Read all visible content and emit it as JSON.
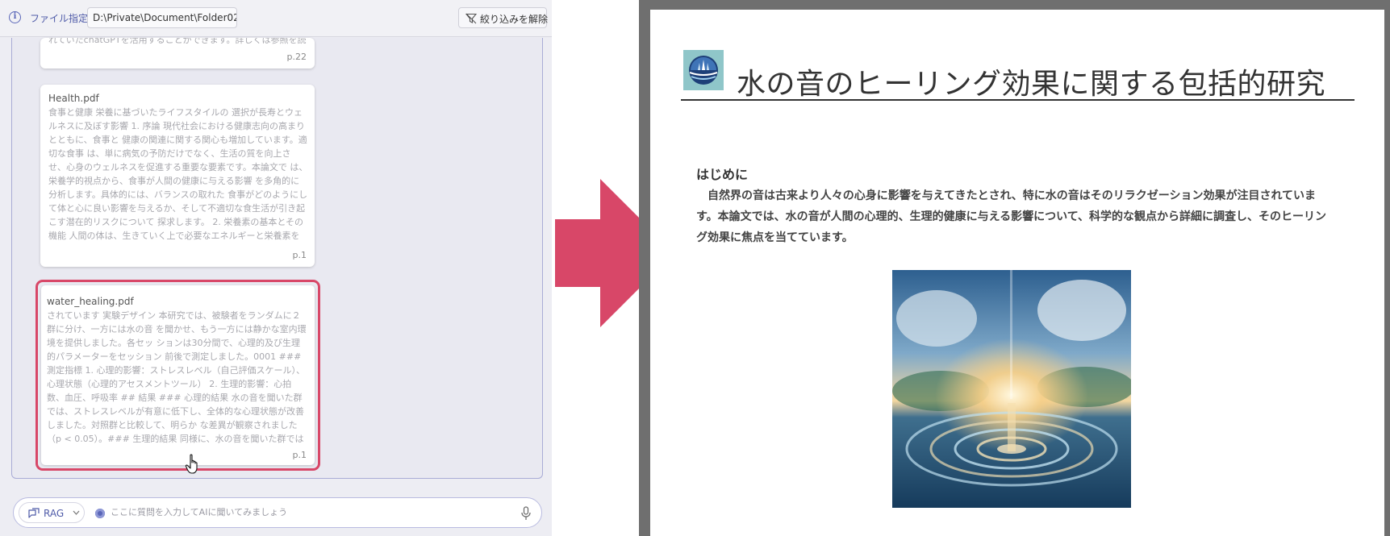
{
  "toolbar": {
    "file_label": "ファイル指定",
    "path": "D:\\Private\\Document\\Folder02\\",
    "filter_clear_label": "絞り込みを解除"
  },
  "results": [
    {
      "title": "",
      "body": "れていたchatGPTを活用することができます。詳しくは参照を読み",
      "page": "p.22"
    },
    {
      "title": "Health.pdf",
      "body": "食事と健康 栄養に基づいたライフスタイルの 選択が長寿とウェルネスに及ぼす影響 1. 序論 現代社会における健康志向の高まりとともに、食事と 健康の関連に関する関心も増加しています。適切な食事 は、単に病気の予防だけでなく、生活の質を向上させ、心身のウェルネスを促進する重要な要素です。本論文で は、栄養学的視点から、食事が人間の健康に与える影響 を多角的に分析します。具体的には、バランスの取れた 食事がどのようにして体と心に良い影響を与えるか、そして不適切な食生活が引き起こす潜在的リスクについて 探求します。 2. 栄養素の基本とその機能 人間の体は、生きていく上で必要なエネルギーと栄養素を食事から取り入",
      "page": "p.1"
    },
    {
      "title": "water_healing.pdf",
      "body": "されています 実験デザイン 本研究では、被験者をランダムに２群に分け、一方には水の音 を聞かせ、もう一方には静かな室内環境を提供しました。各セッ ションは30分間で、心理的及び生理的パラメーターをセッション 前後で測定しました。0001 ### 測定指標 1. 心理的影響：ストレスレベル（自己評価スケール）、心理状態（心理的アセスメントツール） 2. 生理的影響：心拍数、血圧、呼吸率 ## 結果 ### 心理的結果 水の音を聞いた群では、ストレスレベルが有意に低下し、全体的な心理状態が改善しました。対照群と比較して、明らか な差異が観察されました（p < 0.05）。### 生理的結果 同様に、水の音を聞いた群では心拍",
      "page": "p.1"
    }
  ],
  "chat": {
    "mode_label": "RAG",
    "placeholder": "ここに質問を入力してAIに聞いてみましょう"
  },
  "document": {
    "title": "水の音のヒーリング効果に関する包括的研究",
    "section_heading": "はじめに",
    "paragraph": "自然界の音は古来より人々の心身に影響を与えてきたとされ、特に水の音はそのリラクゼーション効果が注目されています。本論文では、水の音が人間の心理的、生理的健康に与える影響について、科学的な観点から詳細に調査し、そのヒーリング効果に焦点を当てています。"
  },
  "colors": {
    "accent": "#5a66b8",
    "highlight": "#d84768",
    "arrow": "#d84768"
  },
  "icons": [
    "info-icon",
    "filter-off-icon",
    "rag-icon",
    "chevron-down-icon",
    "mic-icon",
    "hand-cursor-icon",
    "arrow-right-icon",
    "water-logo",
    "water-ripple-image"
  ]
}
